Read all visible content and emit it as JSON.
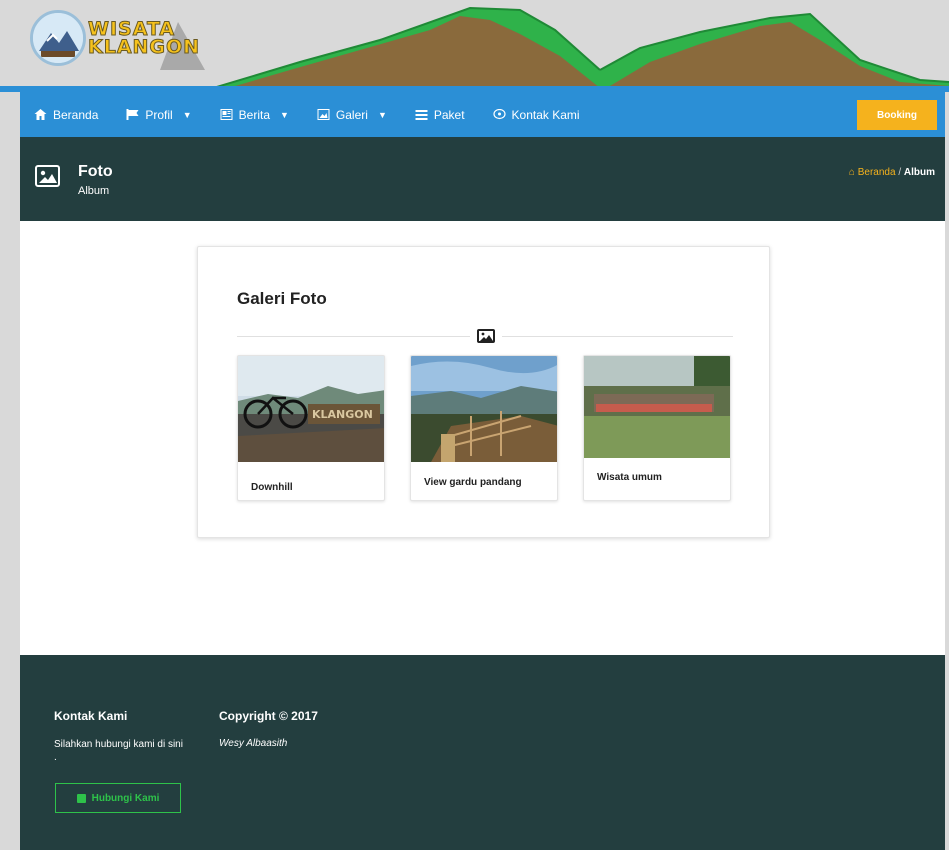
{
  "brand": {
    "logo_line1": "WISATA",
    "logo_line2": "KLANGON"
  },
  "nav": {
    "items": [
      {
        "label": "Beranda",
        "icon": "home-icon",
        "dropdown": false
      },
      {
        "label": "Profil",
        "icon": "flag-icon",
        "dropdown": true
      },
      {
        "label": "Berita",
        "icon": "newspaper-icon",
        "dropdown": true
      },
      {
        "label": "Galeri",
        "icon": "image-icon",
        "dropdown": true
      },
      {
        "label": "Paket",
        "icon": "list-icon",
        "dropdown": false
      },
      {
        "label": "Kontak Kami",
        "icon": "contact-icon",
        "dropdown": false
      }
    ],
    "booking_label": "Booking"
  },
  "page_header": {
    "title": "Foto",
    "subtitle": "Album",
    "breadcrumb_home": "Beranda",
    "breadcrumb_sep": "/",
    "breadcrumb_current": "Album"
  },
  "gallery": {
    "title": "Galeri Foto",
    "items": [
      {
        "caption": "Downhill"
      },
      {
        "caption": "View gardu pandang"
      },
      {
        "caption": "Wisata umum"
      }
    ]
  },
  "footer": {
    "contact_title": "Kontak Kami",
    "contact_text": "Silahkan hubungi kami di sini .",
    "contact_button": "Hubungi Kami",
    "copyright_title": "Copyright © 2017",
    "author": "Wesy Albaasith"
  },
  "colors": {
    "nav": "#2b8fd6",
    "dark": "#233e3f",
    "accent": "#f5b21d",
    "green": "#2ec24a"
  }
}
